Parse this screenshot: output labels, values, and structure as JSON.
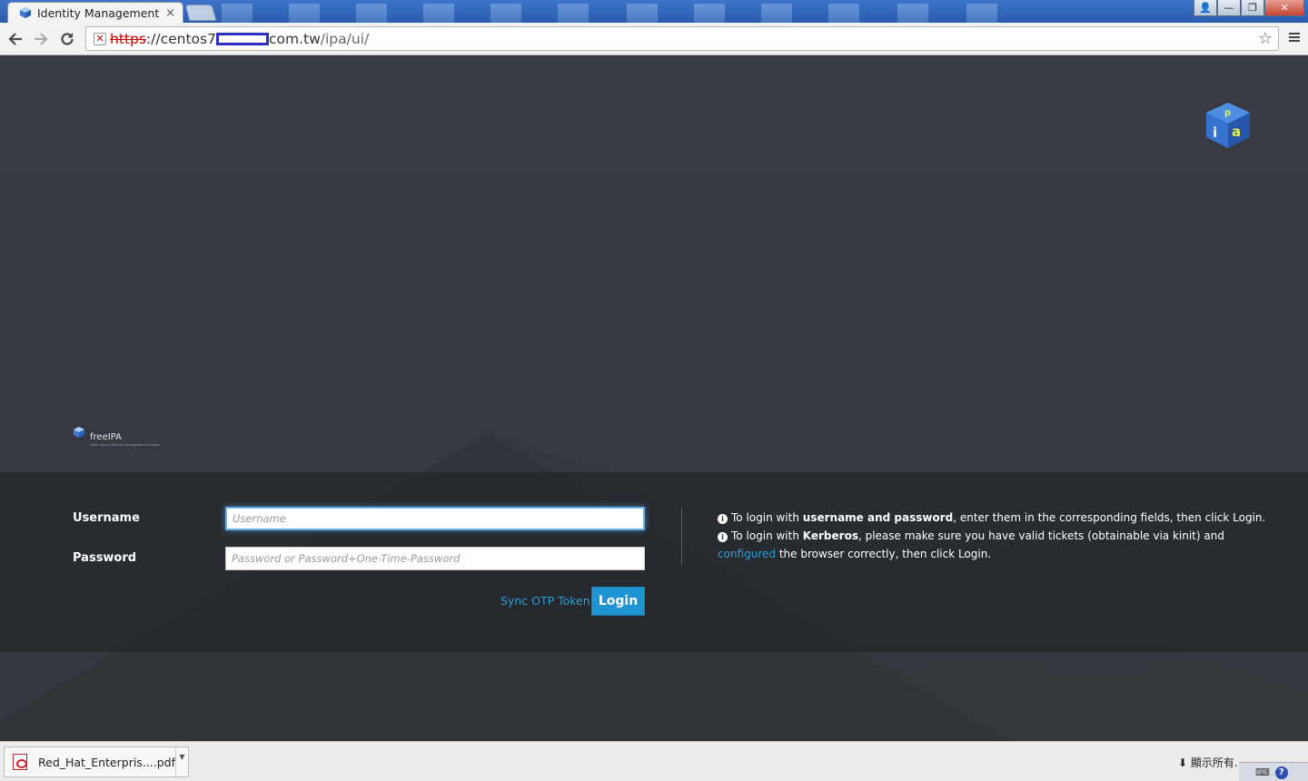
{
  "browser": {
    "tab_title": "Identity Management",
    "tab_close": "×",
    "url_scheme": "https",
    "url_sep": "://",
    "url_host_start": "centos7",
    "url_host_end": "com.tw",
    "url_path": "/ipa/ui/",
    "win_user": "👤",
    "win_minimize": "—",
    "win_maximize": "❐",
    "win_close": "✕"
  },
  "page": {
    "brand_name": "freeIPA",
    "brand_tagline": "Open Source Identity Management Solution"
  },
  "login": {
    "username_label": "Username",
    "password_label": "Password",
    "username_placeholder": "Username",
    "password_placeholder": "Password or Password+One-Time-Password",
    "sync_otp_label": "Sync OTP Token",
    "login_label": "Login"
  },
  "help": {
    "line1_pre": "To login with ",
    "line1_bold": "username and password",
    "line1_post": ", enter them in the corresponding fields, then click Login.",
    "line2_pre": "To login with ",
    "line2_bold": "Kerberos",
    "line2_mid": ", please make sure you have valid tickets (obtainable via kinit) and ",
    "line2_link": "configured",
    "line2_post": " the browser correctly, then click Login."
  },
  "downloads": {
    "filename": "Red_Hat_Enterpris....pdf",
    "show_all": "顯示所有..."
  },
  "colors": {
    "accent": "#1f94d2",
    "link": "#2a9fd8",
    "background": "#383c42"
  }
}
